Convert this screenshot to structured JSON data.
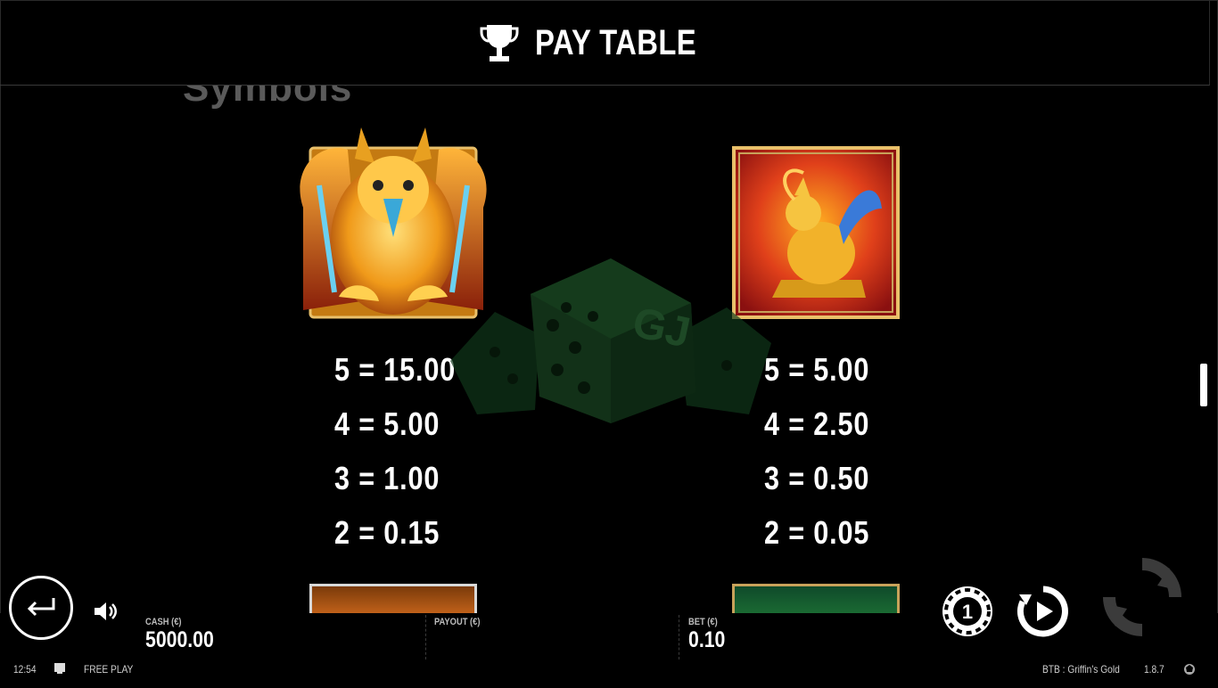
{
  "header": {
    "title": "PAY TABLE",
    "icon": "trophy-icon"
  },
  "section_heading": "Symbols",
  "symbols": [
    {
      "name_icon": "griffin-symbol",
      "payouts": [
        "5 = 15.00",
        "4 = 5.00",
        "3 = 1.00",
        "2 = 0.15"
      ]
    },
    {
      "name_icon": "golden-griffin-statue-symbol",
      "payouts": [
        "5 = 5.00",
        "4 = 2.50",
        "3 = 0.50",
        "2 = 0.05"
      ]
    }
  ],
  "bottom": {
    "cash_label": "CASH (€)",
    "cash_value": "5000.00",
    "payout_label": "PAYOUT (€)",
    "payout_value": "",
    "bet_label": "BET (€)",
    "bet_value": "0.10",
    "chip_value": "1"
  },
  "status": {
    "time": "12:54",
    "mode": "FREE PLAY",
    "game": "BTB : Griffin's Gold",
    "version": "1.8.7"
  },
  "colors": {
    "background": "#000000",
    "text": "#ffffff",
    "muted": "#bdbdbd",
    "gold": "#c8a25a"
  }
}
